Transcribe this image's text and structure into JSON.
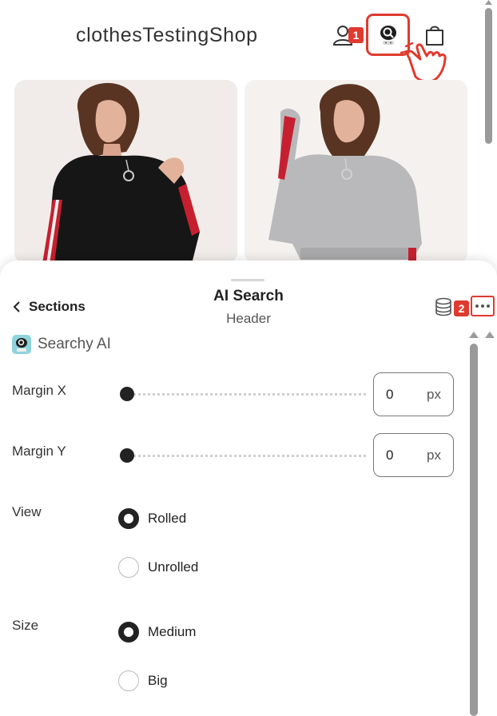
{
  "store": {
    "title": "clothesTestingShop",
    "badge_1": "1",
    "badge_2": "2"
  },
  "panel": {
    "back_label": "Sections",
    "title": "AI Search",
    "subtitle": "Header",
    "app_name": "Searchy AI"
  },
  "fields": {
    "margin_x": {
      "label": "Margin X",
      "value": "0",
      "unit": "px"
    },
    "margin_y": {
      "label": "Margin Y",
      "value": "0",
      "unit": "px"
    },
    "view": {
      "label": "View",
      "options": [
        "Rolled",
        "Unrolled"
      ],
      "selected": "Rolled"
    },
    "size": {
      "label": "Size",
      "options": [
        "Medium",
        "Big"
      ],
      "selected": "Medium"
    }
  },
  "icons": [
    "user-icon",
    "ai-search-icon",
    "shopping-bag-icon",
    "pointer-hand-icon",
    "chevron-left-icon",
    "database-icon",
    "more-dots-icon"
  ],
  "colors": {
    "highlight": "#e03a2f",
    "knob": "#222222"
  }
}
